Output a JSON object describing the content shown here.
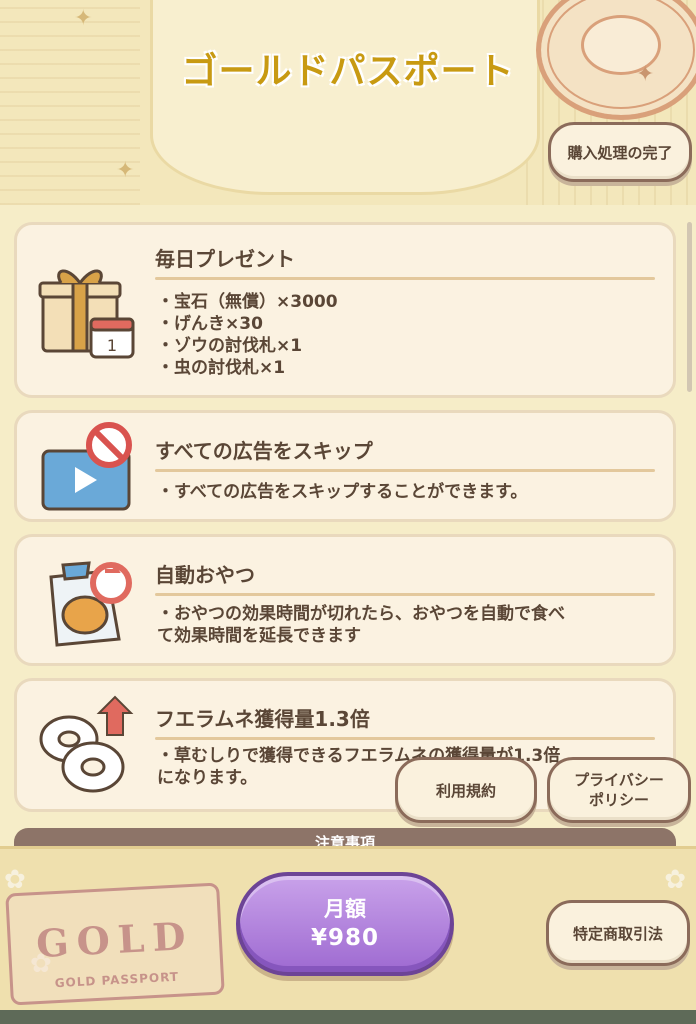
{
  "header": {
    "title": "ゴールドパスポート",
    "purchase_complete_label": "購入処理の完了"
  },
  "cards": [
    {
      "icon": "gift-calendar-icon",
      "title": "毎日プレゼント",
      "lines": [
        "・宝石（無償）×3000",
        "・げんき×30",
        "・ゾウの討伐札×1",
        "・虫の討伐札×1"
      ],
      "calendar_day": "1"
    },
    {
      "icon": "no-ads-icon",
      "title": "すべての広告をスキップ",
      "lines": [
        "・すべての広告をスキップすることができます。"
      ]
    },
    {
      "icon": "auto-snack-icon",
      "title": "自動おやつ",
      "lines": [
        "・おやつの効果時間が切れたら、おやつを自動で食べ",
        "て効果時間を延長できます"
      ]
    },
    {
      "icon": "donut-up-icon",
      "title": "フエラムネ獲得量1.3倍",
      "lines": [
        "・草むしりで獲得できるフエラムネの獲得量が1.3倍",
        "になります。"
      ]
    }
  ],
  "notes_label": "注意事項",
  "links": {
    "terms": "利用規約",
    "privacy_line1": "プライバシー",
    "privacy_line2": "ポリシー",
    "commerce_law": "特定商取引法"
  },
  "price": {
    "label": "月額",
    "amount": "¥980"
  },
  "badge": {
    "text": "GOLD",
    "subtext": "GOLD PASSPORT"
  },
  "colors": {
    "accent_gold": "#c89a12",
    "price_purple": "#9e6ad1"
  }
}
